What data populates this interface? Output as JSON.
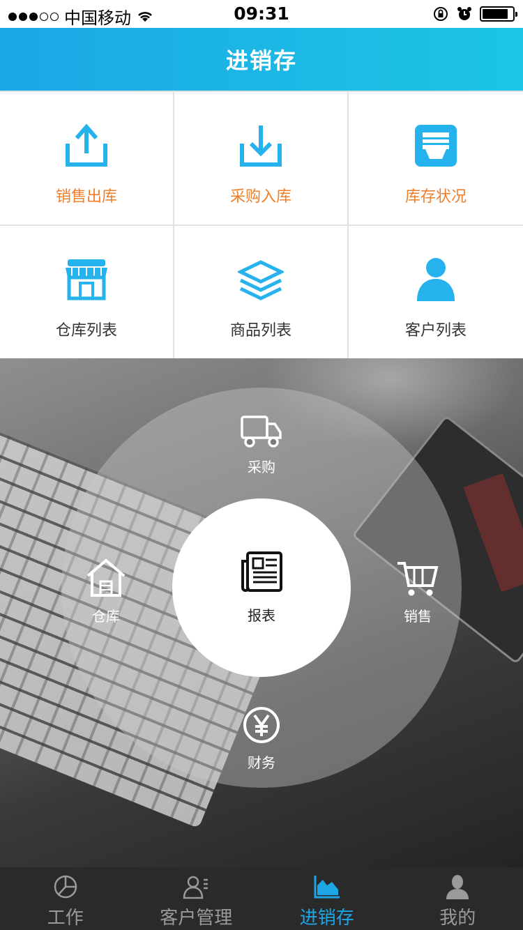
{
  "status_bar": {
    "carrier": "中国移动",
    "time": "09:31",
    "signal_dots": [
      true,
      true,
      true,
      false,
      false
    ]
  },
  "header": {
    "title": "进销存"
  },
  "grid": {
    "items": [
      {
        "label": "销售出库",
        "icon": "upload-icon",
        "color": "#f07d28"
      },
      {
        "label": "采购入库",
        "icon": "download-icon",
        "color": "#f07d28"
      },
      {
        "label": "库存状况",
        "icon": "inventory-icon",
        "color": "#f07d28"
      },
      {
        "label": "仓库列表",
        "icon": "store-icon",
        "color": "#333333"
      },
      {
        "label": "商品列表",
        "icon": "layers-icon",
        "color": "#333333"
      },
      {
        "label": "客户列表",
        "icon": "person-icon",
        "color": "#333333"
      }
    ],
    "icon_color": "#26b2ec"
  },
  "radial_menu": {
    "top": {
      "label": "采购",
      "icon": "truck-icon"
    },
    "left": {
      "label": "仓库",
      "icon": "warehouse-icon"
    },
    "center": {
      "label": "报表",
      "icon": "report-icon"
    },
    "right": {
      "label": "销售",
      "icon": "cart-icon"
    },
    "bottom": {
      "label": "财务",
      "icon": "yen-icon"
    }
  },
  "tab_bar": {
    "tabs": [
      {
        "label": "工作",
        "icon": "pie-chart-icon",
        "active": false
      },
      {
        "label": "客户管理",
        "icon": "contacts-icon",
        "active": false
      },
      {
        "label": "进销存",
        "icon": "area-chart-icon",
        "active": true
      },
      {
        "label": "我的",
        "icon": "user-icon",
        "active": false
      }
    ],
    "active_color": "#1ca6e6"
  }
}
